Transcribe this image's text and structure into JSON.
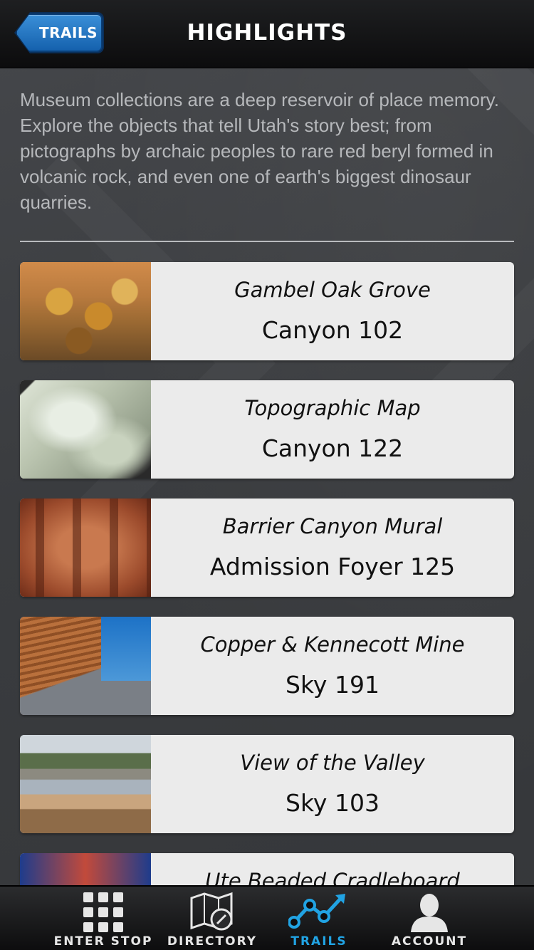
{
  "header": {
    "back_label": "TRAILS",
    "title": "HIGHLIGHTS"
  },
  "intro": "Museum collections are a deep reservoir of place memory. Explore the objects that tell Utah's story best; from pictographs by archaic peoples to rare red beryl formed in volcanic rock, and even one of earth's biggest dinosaur quarries.",
  "items": [
    {
      "title": "Gambel Oak Grove",
      "location": "Canyon 102",
      "image": "gambel-oak-photo"
    },
    {
      "title": "Topographic Map",
      "location": "Canyon 122",
      "image": "topographic-map-photo"
    },
    {
      "title": "Barrier Canyon Mural",
      "location": "Admission Foyer 125",
      "image": "pictograph-mural-photo"
    },
    {
      "title": "Copper & Kennecott Mine",
      "location": "Sky 191",
      "image": "copper-building-photo"
    },
    {
      "title": "View of the Valley",
      "location": "Sky 103",
      "image": "valley-view-photo"
    },
    {
      "title": "Ute Beaded Cradleboard",
      "location": "",
      "image": "cradleboard-photo"
    }
  ],
  "tabbar": {
    "tabs": [
      {
        "label": "ENTER STOP",
        "icon": "keypad-icon",
        "active": false
      },
      {
        "label": "DIRECTORY",
        "icon": "map-compass-icon",
        "active": false
      },
      {
        "label": "TRAILS",
        "icon": "trail-graph-icon",
        "active": true
      },
      {
        "label": "ACCOUNT",
        "icon": "person-icon",
        "active": false
      }
    ]
  },
  "colors": {
    "accent": "#21a3e3",
    "back_button": "#1f74c4",
    "card": "#ebebeb",
    "background": "#3b3d40"
  }
}
